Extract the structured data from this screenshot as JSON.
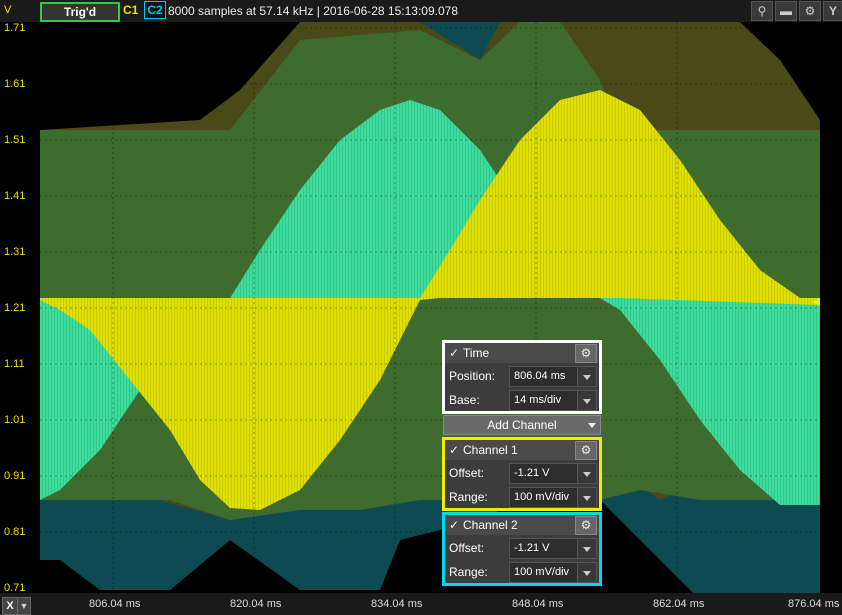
{
  "header": {
    "v_label": "V",
    "trig_label": "Trig'd",
    "c1_label": "C1",
    "c2_label": "C2",
    "info": "8000 samples at 57.14 kHz | 2016-06-28 15:13:09.078",
    "y_button": "Y"
  },
  "y_axis": [
    "1.71",
    "1.61",
    "1.51",
    "1.41",
    "1.31",
    "1.21",
    "1.11",
    "1.01",
    "0.91",
    "0.81",
    "0.71"
  ],
  "x_axis": [
    "806.04 ms",
    "820.04 ms",
    "834.04 ms",
    "848.04 ms",
    "862.04 ms",
    "876.04 ms"
  ],
  "x_button": "X",
  "time_panel": {
    "title": "Time",
    "position_label": "Position:",
    "position_value": "806.04 ms",
    "base_label": "Base:",
    "base_value": "14 ms/div"
  },
  "add_channel": "Add Channel",
  "channel1": {
    "title": "Channel 1",
    "offset_label": "Offset:",
    "offset_value": "-1.21 V",
    "range_label": "Range:",
    "range_value": "100 mV/div"
  },
  "channel2": {
    "title": "Channel 2",
    "offset_label": "Offset:",
    "offset_value": "-1.21 V",
    "range_label": "Range:",
    "range_value": "100 mV/div"
  },
  "colors": {
    "channel1": "#f5ea00",
    "channel2": "#00d8f0",
    "trigger": "#2ecc40"
  }
}
